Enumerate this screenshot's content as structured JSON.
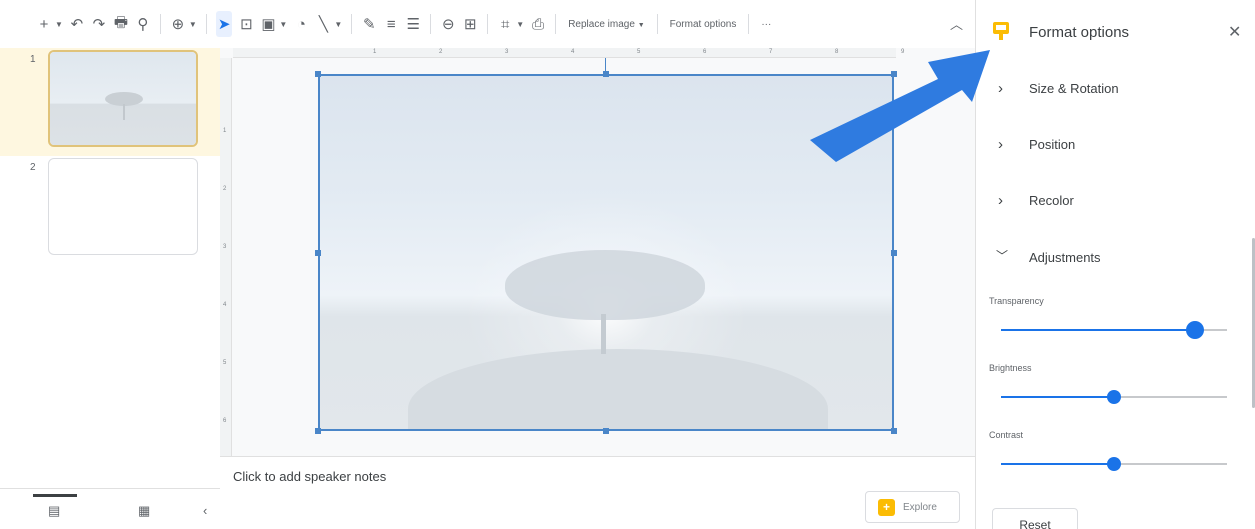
{
  "toolbar": {
    "replace_image_label": "Replace image",
    "format_options_label": "Format options",
    "more_label": "···"
  },
  "filmstrip": {
    "slides": [
      {
        "number": "1"
      },
      {
        "number": "2"
      }
    ]
  },
  "ruler": {
    "top_labels": [
      "1",
      "2",
      "3",
      "4",
      "5",
      "6",
      "7",
      "8",
      "9"
    ],
    "left_labels": [
      "1",
      "2",
      "3",
      "4",
      "5",
      "6"
    ]
  },
  "notes": {
    "placeholder": "Click to add speaker notes"
  },
  "explore": {
    "label": "Explore"
  },
  "panel": {
    "title": "Format options",
    "sections": [
      {
        "label": "Size & Rotation",
        "expanded": false
      },
      {
        "label": "Position",
        "expanded": false
      },
      {
        "label": "Recolor",
        "expanded": false
      },
      {
        "label": "Adjustments",
        "expanded": true
      }
    ],
    "sliders": [
      {
        "label": "Transparency",
        "value": 0.86
      },
      {
        "label": "Brightness",
        "value": 0.5
      },
      {
        "label": "Contrast",
        "value": 0.5
      }
    ],
    "reset_label": "Reset"
  },
  "colors": {
    "accent": "#1a73e8",
    "selection": "#4a86c8",
    "annotation_arrow": "#2f7be0",
    "selected_slide_bg": "#fef7e0"
  }
}
